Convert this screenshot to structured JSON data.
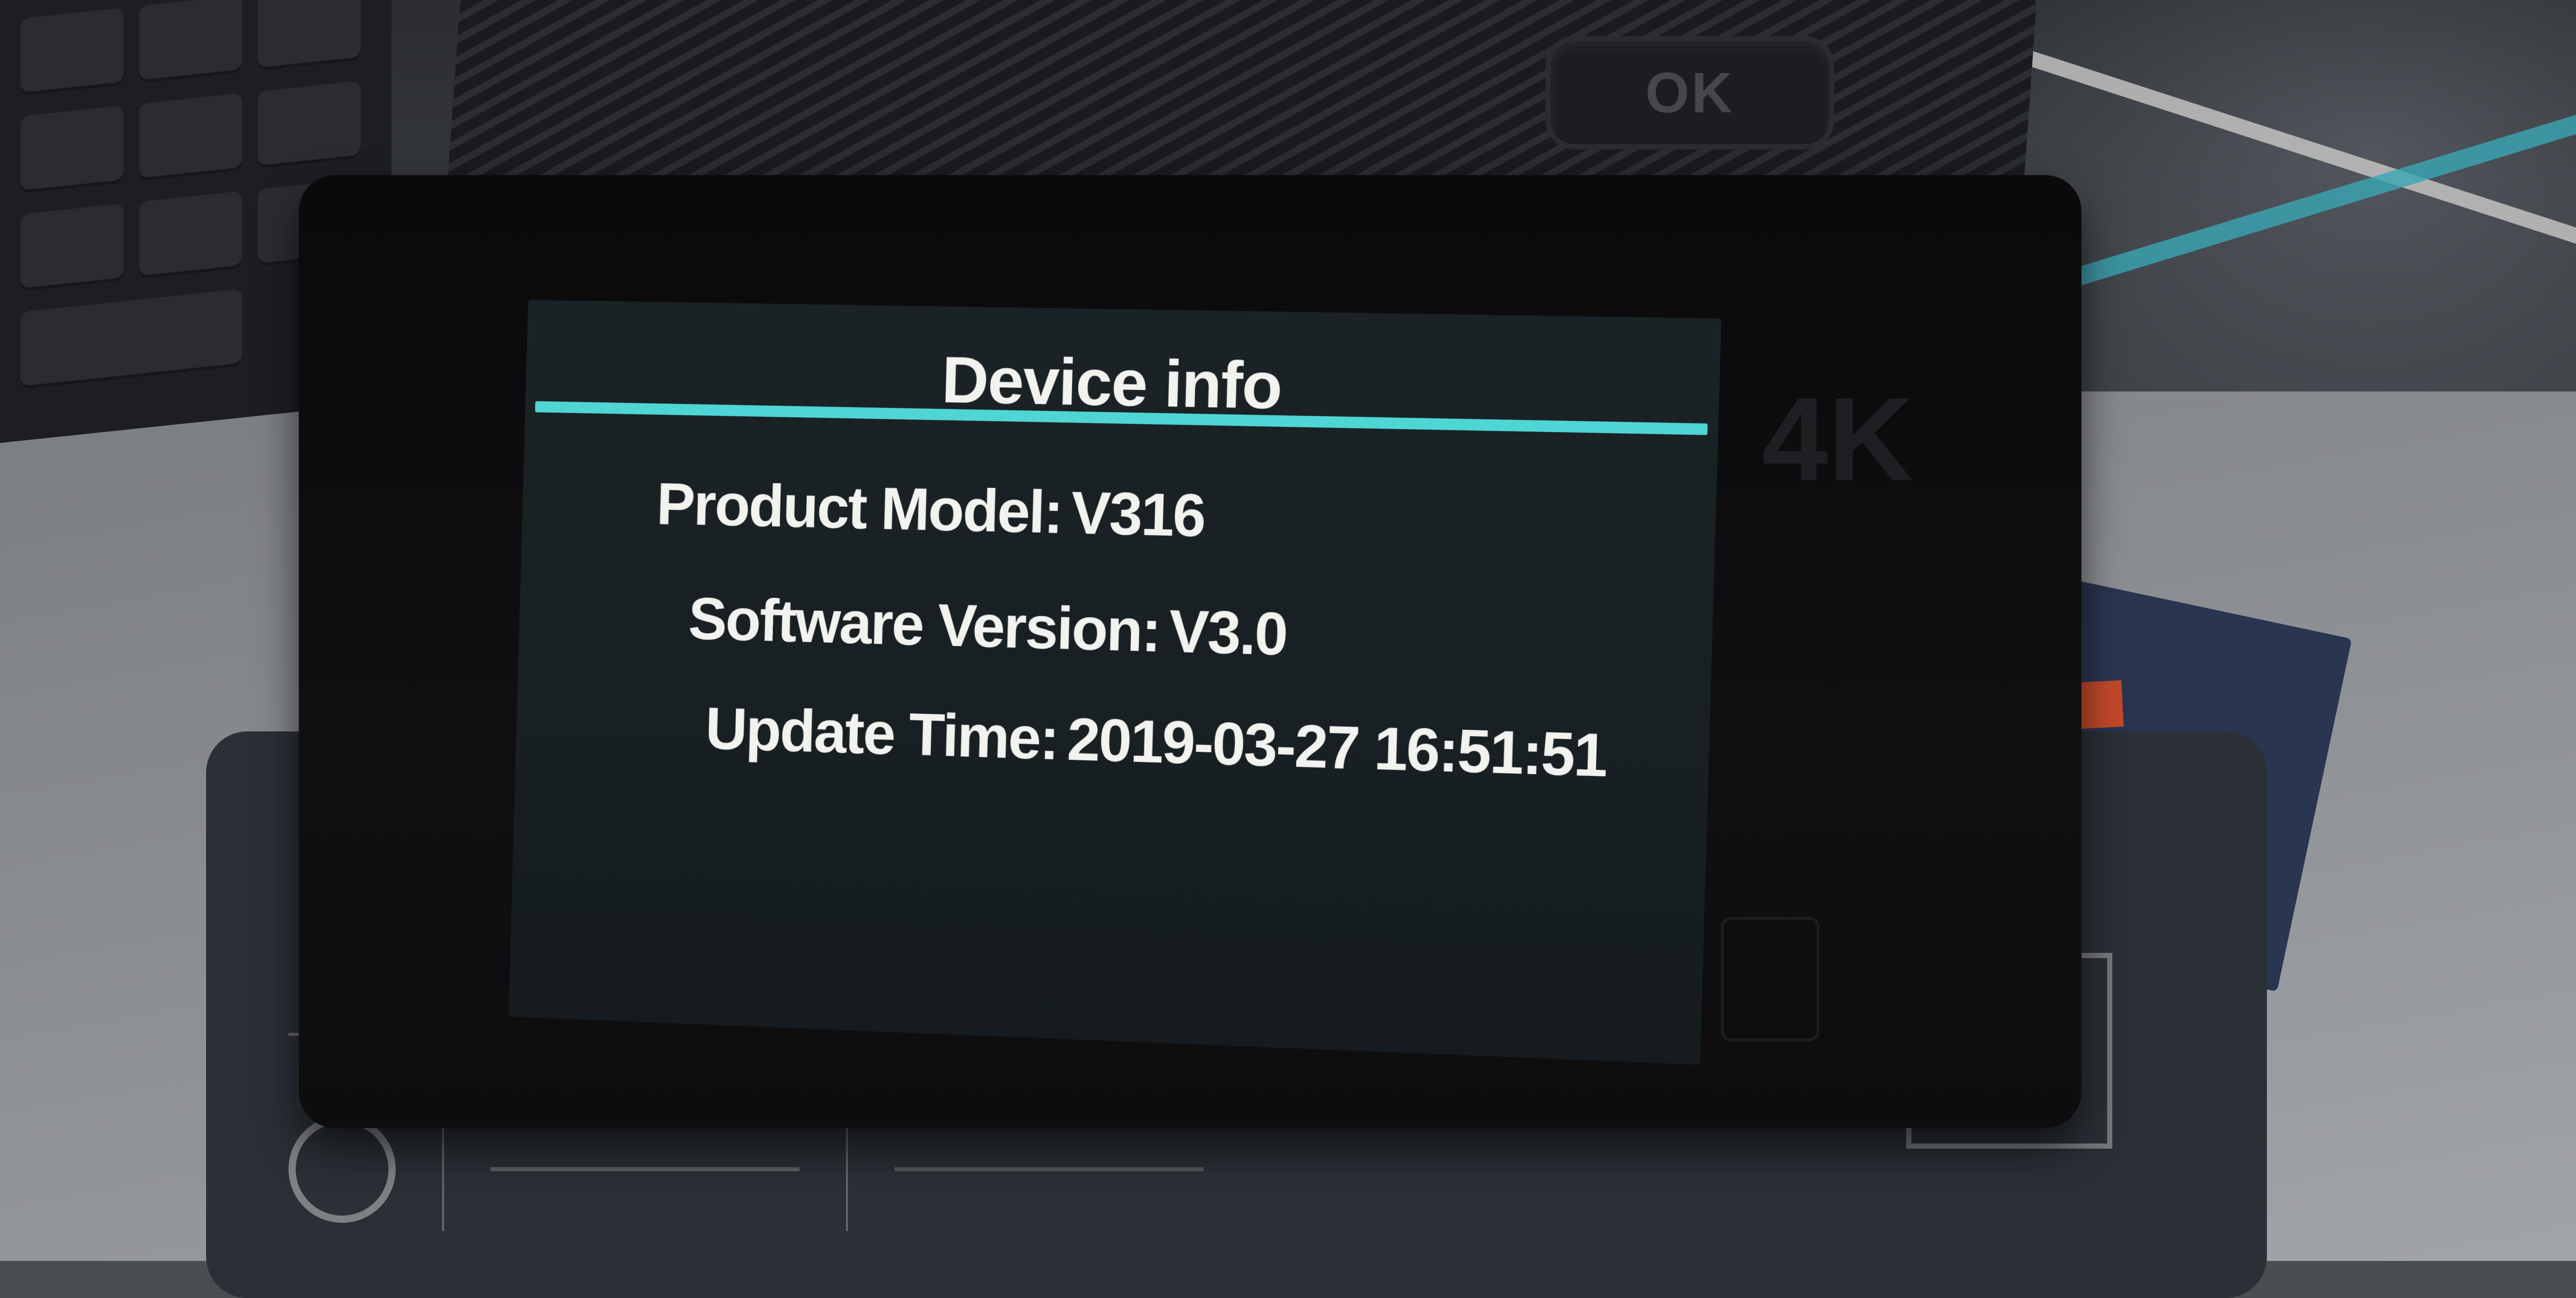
{
  "screen": {
    "title": "Device info",
    "accent_color": "#4fd6d4",
    "rows": [
      {
        "label": "Product Model:",
        "value": "V316"
      },
      {
        "label": "Software Version:",
        "value": "V3.0"
      },
      {
        "label": "Update Time:",
        "value": "2019-03-27 16:51:51"
      }
    ]
  },
  "camera": {
    "ok_button_label": "OK",
    "side_brand": "4K"
  }
}
